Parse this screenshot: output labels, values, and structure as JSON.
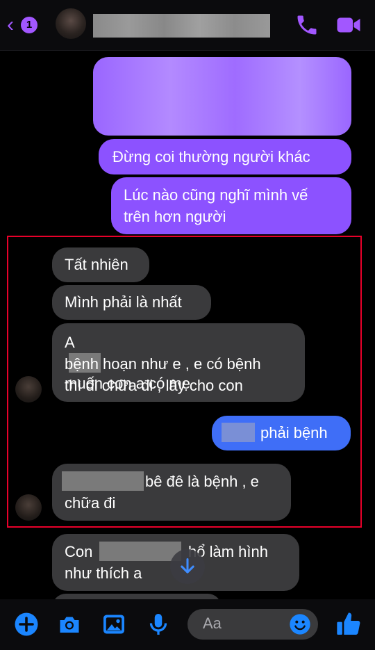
{
  "header": {
    "unread_count": "1",
    "icons": [
      "chevron-left-icon",
      "phone-icon",
      "video-camera-icon"
    ]
  },
  "messages": {
    "out_1_line1": "Đừng coi thường người khác",
    "out_2_line1": "Lúc nào cũng nghĩ mình vế",
    "out_2_line2": "trên hơn người",
    "in_1": "Tất nhiên",
    "in_2": "Mình phải là nhất",
    "in_3_line1_a": "A",
    "in_3_line1_b": "muốn con a có mẹ",
    "in_3_line2": "bệnh hoạn như e , e có bệnh",
    "in_3_line3": "thì đi chữa đi , lây cho con",
    "out_3_after": "phải bệnh",
    "in_4_line1_after": "bê đê là bệnh , e",
    "in_4_line2": "chữa đi",
    "in_5_line1_a": "Con",
    "in_5_line1_b": "hổ làm hình",
    "in_5_line2": "như thích a"
  },
  "composer": {
    "placeholder": "Aa",
    "icons": [
      "plus-icon",
      "camera-icon",
      "image-icon",
      "microphone-icon",
      "emoji-icon",
      "thumbs-up-icon"
    ]
  },
  "colors": {
    "outgoing_purple": "#8c52ff",
    "outgoing_blue": "#3f6ef7",
    "incoming_gray": "#3a3a3c",
    "accent": "#a257ff",
    "composer_blue": "#1b86ff",
    "highlight_frame": "#e8002a"
  }
}
